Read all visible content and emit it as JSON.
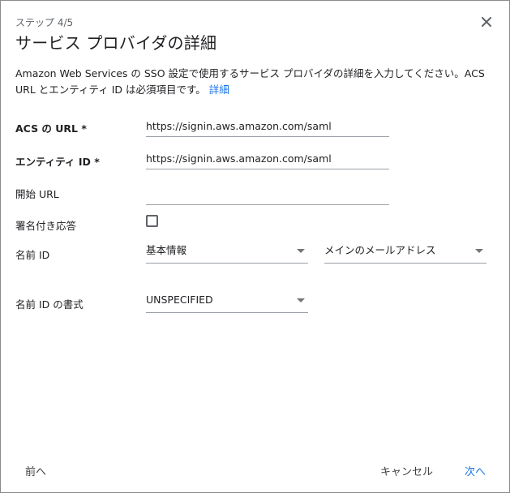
{
  "header": {
    "step": "ステップ 4/5",
    "title": "サービス プロバイダの詳細"
  },
  "description": {
    "text": "Amazon Web Services の SSO 設定で使用するサービス プロバイダの詳細を入力してください。ACS URL とエンティティ ID は必須項目です。",
    "link": "詳細"
  },
  "fields": {
    "acs_url": {
      "label": "ACS の URL *",
      "value": "https://signin.aws.amazon.com/saml"
    },
    "entity_id": {
      "label": "エンティティ ID *",
      "value": "https://signin.aws.amazon.com/saml"
    },
    "start_url": {
      "label": "開始 URL",
      "value": ""
    },
    "signed_response": {
      "label": "署名付き応答"
    },
    "name_id": {
      "label": "名前 ID",
      "select1": "基本情報",
      "select2": "メインのメールアドレス"
    },
    "name_id_format": {
      "label": "名前 ID の書式",
      "select": "UNSPECIFIED"
    }
  },
  "footer": {
    "back": "前へ",
    "cancel": "キャンセル",
    "next": "次へ"
  },
  "icons": {
    "close": "close-icon",
    "caret": "caret-down-icon"
  },
  "colors": {
    "link": "#1a73e8",
    "text": "#202124",
    "line": "#9aa0a6"
  }
}
